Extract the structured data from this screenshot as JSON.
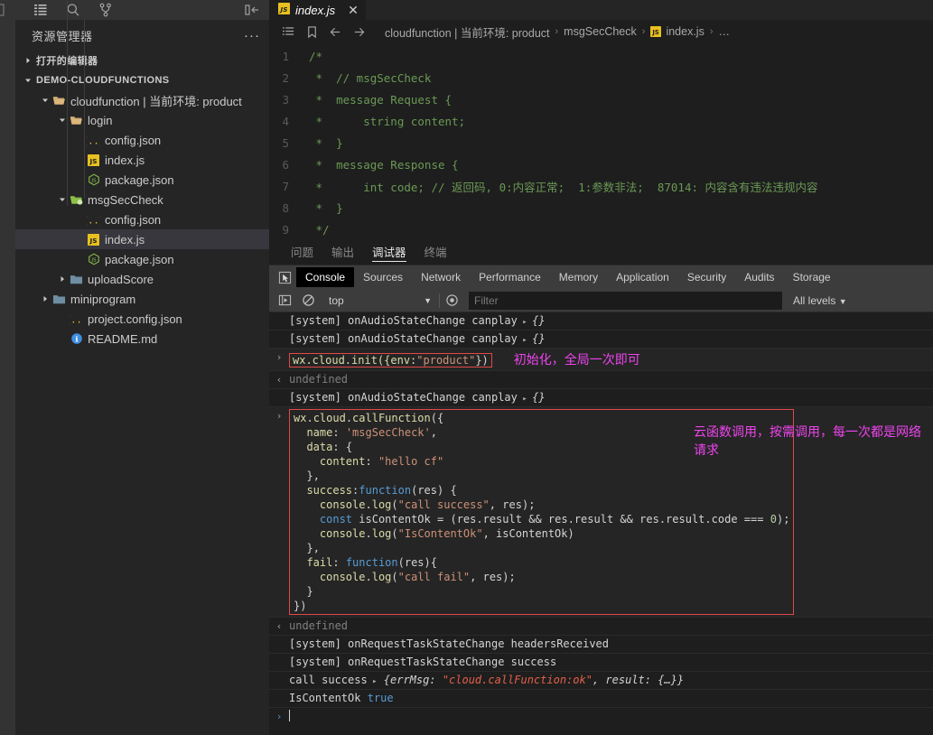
{
  "activity_bar": {
    "icons": [
      "files-icon",
      "search-icon",
      "source-control-icon"
    ]
  },
  "sidebar": {
    "title": "资源管理器",
    "more_label": "···",
    "collapse_icon": "collapse-sidebar-icon",
    "sections": [
      {
        "label": "打开的编辑器",
        "expanded": false
      },
      {
        "label": "DEMO-CLOUDFUNCTIONS",
        "expanded": true
      }
    ],
    "tree": [
      {
        "label": "cloudfunction | 当前环境: product",
        "icon": "folder-open-icon",
        "depth": 1,
        "twisty": "down",
        "selected": false
      },
      {
        "label": "login",
        "icon": "folder-open-icon",
        "depth": 2,
        "twisty": "down",
        "selected": false
      },
      {
        "label": "config.json",
        "icon": "json-icon",
        "depth": 3,
        "twisty": "none",
        "selected": false
      },
      {
        "label": "index.js",
        "icon": "js-icon",
        "depth": 3,
        "twisty": "none",
        "selected": false
      },
      {
        "label": "package.json",
        "icon": "nodejs-icon",
        "depth": 3,
        "twisty": "none",
        "selected": false
      },
      {
        "label": "msgSecCheck",
        "icon": "folder-open-node-icon",
        "depth": 2,
        "twisty": "down",
        "selected": false
      },
      {
        "label": "config.json",
        "icon": "json-icon",
        "depth": 3,
        "twisty": "none",
        "selected": false
      },
      {
        "label": "index.js",
        "icon": "js-icon",
        "depth": 3,
        "twisty": "none",
        "selected": true
      },
      {
        "label": "package.json",
        "icon": "nodejs-icon",
        "depth": 3,
        "twisty": "none",
        "selected": false
      },
      {
        "label": "uploadScore",
        "icon": "folder-icon",
        "depth": 2,
        "twisty": "right",
        "selected": false
      },
      {
        "label": "miniprogram",
        "icon": "folder-icon",
        "depth": 1,
        "twisty": "right",
        "selected": false
      },
      {
        "label": "project.config.json",
        "icon": "json-icon",
        "depth": 2,
        "twisty": "none",
        "selected": false
      },
      {
        "label": "README.md",
        "icon": "info-icon",
        "depth": 2,
        "twisty": "none",
        "selected": false
      }
    ]
  },
  "editor": {
    "tab": {
      "label": "index.js",
      "icon": "js-icon",
      "close": "✕"
    },
    "breadcrumb": {
      "icons": [
        "outline-icon",
        "bookmark-icon",
        "nav-back-icon",
        "nav-forward-icon"
      ],
      "segments": [
        "cloudfunction | 当前环境: product",
        "msgSecCheck",
        "index.js",
        "…"
      ],
      "separator": "›"
    },
    "lines": [
      {
        "n": "1",
        "text": "/*"
      },
      {
        "n": "2",
        "text": " *  // msgSecCheck"
      },
      {
        "n": "3",
        "text": " *  message Request {"
      },
      {
        "n": "4",
        "text": " *      string content;"
      },
      {
        "n": "5",
        "text": " *  }"
      },
      {
        "n": "6",
        "text": " *  message Response {"
      },
      {
        "n": "7",
        "text": " *      int code; // 返回码, 0:内容正常;  1:参数非法;  87014: 内容含有违法违规内容"
      },
      {
        "n": "8",
        "text": " *  }"
      },
      {
        "n": "9",
        "text": " */"
      }
    ]
  },
  "panel": {
    "tabs": [
      {
        "label": "问题",
        "active": false
      },
      {
        "label": "输出",
        "active": false
      },
      {
        "label": "调试器",
        "active": true
      },
      {
        "label": "终端",
        "active": false
      }
    ]
  },
  "devtools": {
    "inspect_icon": "inspect-element-icon",
    "tabs": [
      {
        "label": "Console",
        "active": true
      },
      {
        "label": "Sources",
        "active": false
      },
      {
        "label": "Network",
        "active": false
      },
      {
        "label": "Performance",
        "active": false
      },
      {
        "label": "Memory",
        "active": false
      },
      {
        "label": "Application",
        "active": false
      },
      {
        "label": "Security",
        "active": false
      },
      {
        "label": "Audits",
        "active": false
      },
      {
        "label": "Storage",
        "active": false
      }
    ],
    "toolbar": {
      "sidebar_toggle_icon": "console-sidebar-icon",
      "clear_icon": "clear-console-icon",
      "context_value": "top",
      "context_caret": "▼",
      "eye_icon": "live-expression-icon",
      "filter_placeholder": "Filter",
      "filter_value": "",
      "levels_label": "All levels",
      "levels_caret": "▼"
    }
  },
  "console_log": {
    "rows": [
      {
        "type": "system",
        "gutter": "",
        "text": "[system] onAudioStateChange canplay",
        "obj": "{}"
      },
      {
        "type": "system",
        "gutter": "",
        "text": "[system] onAudioStateChange canplay",
        "obj": "{}"
      },
      {
        "type": "input-boxed",
        "gutter": "›",
        "annotation": "初始化，全局一次即可"
      },
      {
        "type": "result",
        "gutter": "‹",
        "text": "undefined"
      },
      {
        "type": "system",
        "gutter": "",
        "text": "[system] onAudioStateChange canplay",
        "obj": "{}"
      },
      {
        "type": "code-block",
        "gutter": "›",
        "annotation": "云函数调用，按需调用，每一次都是网络请求"
      },
      {
        "type": "result",
        "gutter": "‹",
        "text": "undefined"
      },
      {
        "type": "system",
        "gutter": "",
        "text": "[system] onRequestTaskStateChange headersReceived",
        "obj": ""
      },
      {
        "type": "system",
        "gutter": "",
        "text": "[system] onRequestTaskStateChange success",
        "obj": ""
      },
      {
        "type": "call-success",
        "gutter": "",
        "label": "call success",
        "errmsg_key": "errMsg: ",
        "errmsg_val": "\"cloud.callFunction:ok\"",
        "rest": ", result: {…}}"
      },
      {
        "type": "iscontentok",
        "gutter": "",
        "label": "IsContentOk",
        "value": "true"
      },
      {
        "type": "prompt",
        "gutter": "›",
        "text": ""
      }
    ],
    "init_code": {
      "p1": "wx.cloud.init({env:",
      "p2": "\"product\"",
      "p3": "})"
    },
    "call_code_lines": [
      "wx.cloud.callFunction({",
      "  name: 'msgSecCheck',",
      "  data: {",
      "    content: \"hello cf\"",
      "  },",
      "  success:function(res) {",
      "    console.log(\"call success\", res);",
      "    const isContentOk = (res.result && res.result && res.result.code === 0);",
      "    console.log(\"IsContentOk\", isContentOk)",
      "  },",
      "  fail: function(res){",
      "    console.log(\"call fail\", res);",
      "  }",
      "})"
    ]
  },
  "colors": {
    "accent_red": "#e04848",
    "annotation_magenta": "#ee44ee",
    "editor_bg": "#1e1e1e",
    "sidebar_bg": "#252526",
    "comment_green": "#6a9955"
  }
}
